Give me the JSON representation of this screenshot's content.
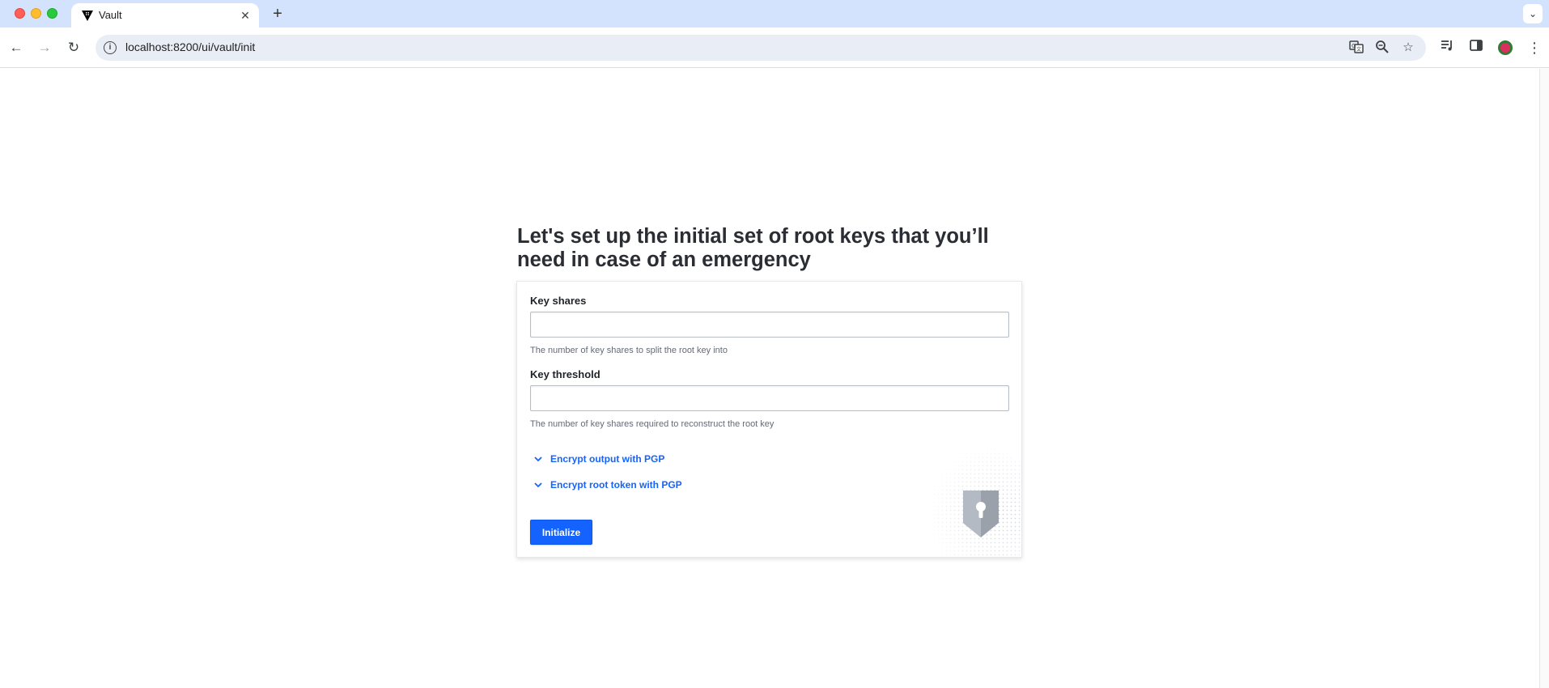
{
  "browser": {
    "tab_title": "Vault",
    "url": "localhost:8200/ui/vault/init",
    "icons": [
      "info-icon",
      "translate-icon",
      "zoom-icon",
      "star-icon",
      "media-icon",
      "side-panel-icon",
      "profile-avatar",
      "more-icon"
    ]
  },
  "page": {
    "title": "Let's set up the initial set of root keys that you’ll need in case of an emergency"
  },
  "form": {
    "key_shares": {
      "label": "Key shares",
      "value": "",
      "help": "The number of key shares to split the root key into"
    },
    "key_threshold": {
      "label": "Key threshold",
      "value": "",
      "help": "The number of key shares required to reconstruct the root key"
    },
    "toggles": [
      {
        "label": "Encrypt output with PGP"
      },
      {
        "label": "Encrypt root token with PGP"
      }
    ],
    "submit_label": "Initialize"
  },
  "colors": {
    "accent": "#1563ff",
    "tabbar": "#d3e3fd",
    "omnibox": "#e9eef6"
  }
}
